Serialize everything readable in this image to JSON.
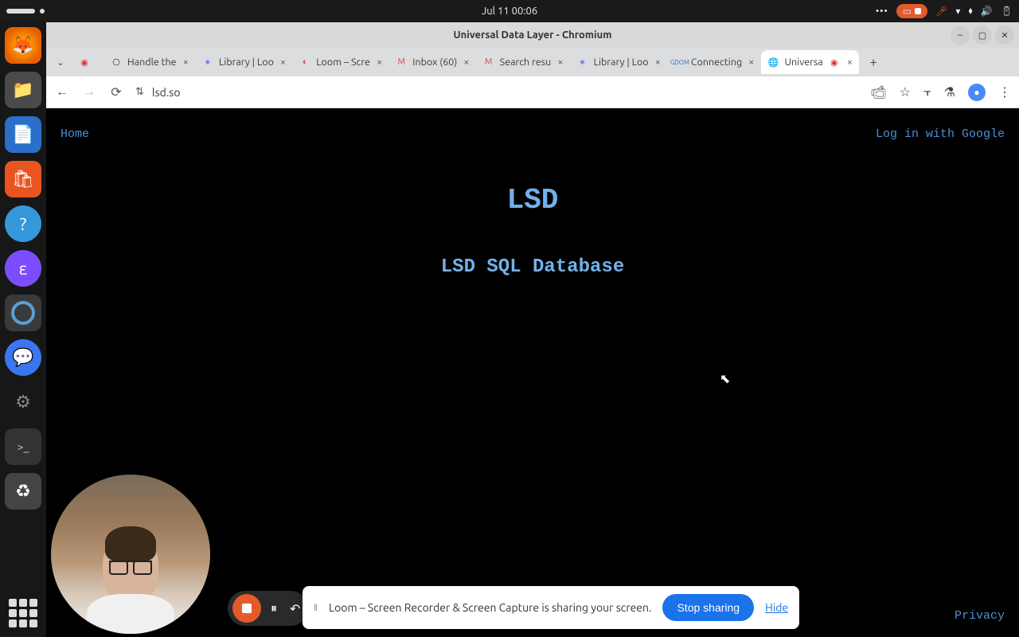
{
  "gnome": {
    "datetime": "Jul 11  00:06"
  },
  "window": {
    "title": "Universal Data Layer - Chromium"
  },
  "tabs": [
    {
      "label": "",
      "favicon": "rec"
    },
    {
      "label": "Handle the",
      "favicon": "github"
    },
    {
      "label": "Library | Loo",
      "favicon": "loom"
    },
    {
      "label": "Loom – Scre",
      "favicon": "loom-red"
    },
    {
      "label": "Inbox (60)",
      "favicon": "gmail"
    },
    {
      "label": "Search resu",
      "favicon": "gmail"
    },
    {
      "label": "Library | Loo",
      "favicon": "loom"
    },
    {
      "label": "Connecting",
      "favicon": "gdom"
    },
    {
      "label": "Universa",
      "favicon": "globe",
      "active": true,
      "extra": "rec"
    }
  ],
  "url": "lsd.so",
  "page": {
    "home": "Home",
    "login": "Log in with Google",
    "title": "LSD",
    "subtitle": "LSD SQL Database",
    "privacy": "Privacy"
  },
  "share": {
    "text": "Loom – Screen Recorder & Screen Capture is sharing your screen.",
    "stop": "Stop sharing",
    "hide": "Hide"
  }
}
